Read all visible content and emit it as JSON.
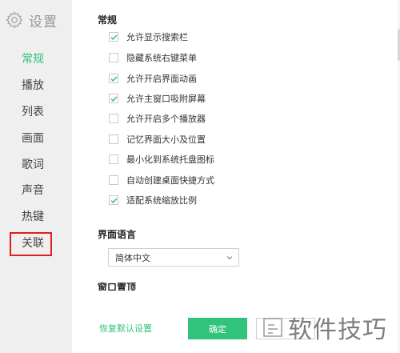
{
  "sidebar": {
    "title": "设置",
    "items": [
      {
        "label": "常规",
        "active": true
      },
      {
        "label": "播放",
        "active": false
      },
      {
        "label": "列表",
        "active": false
      },
      {
        "label": "画面",
        "active": false
      },
      {
        "label": "歌词",
        "active": false
      },
      {
        "label": "声音",
        "active": false
      },
      {
        "label": "热键",
        "active": false
      },
      {
        "label": "关联",
        "active": false
      }
    ]
  },
  "general": {
    "title": "常规",
    "options": [
      {
        "label": "允许显示搜索栏",
        "checked": true
      },
      {
        "label": "隐藏系统右键菜单",
        "checked": false
      },
      {
        "label": "允许开启界面动画",
        "checked": true
      },
      {
        "label": "允许主窗口吸附屏幕",
        "checked": true
      },
      {
        "label": "允许开启多个播放器",
        "checked": false
      },
      {
        "label": "记忆界面大小及位置",
        "checked": false
      },
      {
        "label": "最小化到系统托盘图标",
        "checked": false
      },
      {
        "label": "自动创建桌面快捷方式",
        "checked": false
      },
      {
        "label": "适配系统缩放比例",
        "checked": true
      }
    ]
  },
  "language": {
    "title": "界面语言",
    "selected": "简体中文"
  },
  "next_section": {
    "title": "窗口置顶"
  },
  "footer": {
    "reset_label": "恢复默认设置",
    "ok_label": "确定"
  },
  "watermark": {
    "text": "软件技巧"
  },
  "colors": {
    "accent": "#31c27c",
    "sidebar_bg": "#efefef",
    "highlight_box": "#e02020"
  }
}
